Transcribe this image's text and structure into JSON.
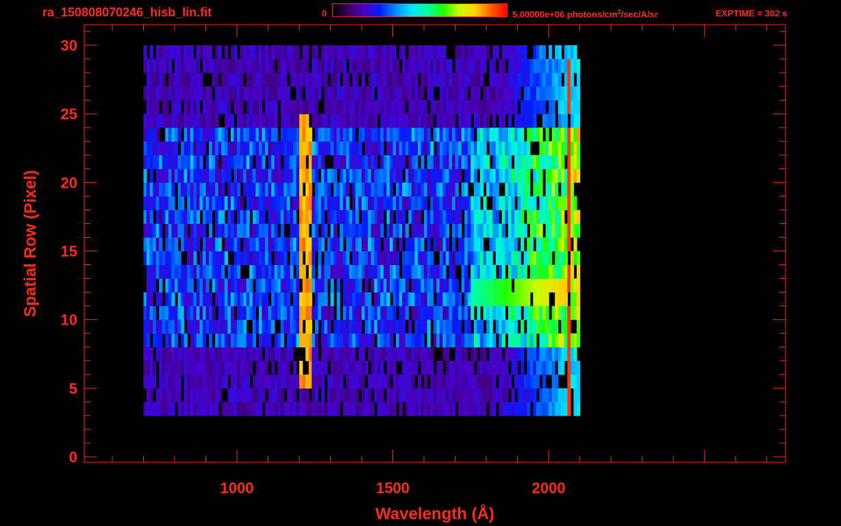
{
  "header": {
    "title": "ra_150808070246_hisb_lin.fit",
    "colorbar_min": "0",
    "colorbar_max_value": "5.00000e+06",
    "colorbar_units_prefix": "photons/cm",
    "colorbar_units_sup": "2",
    "colorbar_units_suffix": "/sec/A/sr",
    "exptime": "EXPTIME = 302 s"
  },
  "colors": {
    "text": "#ff2a1a",
    "axis": "#ff2a1a",
    "background": "#000000",
    "colormap": [
      "#000000",
      "#3a0060",
      "#4a00c8",
      "#0020ff",
      "#0090ff",
      "#00e6ff",
      "#00ffa0",
      "#20ff00",
      "#c8ff00",
      "#ffd000",
      "#ff6000",
      "#ff0000"
    ]
  },
  "chart_data": {
    "type": "heatmap",
    "xlabel": "Wavelength (Å)",
    "ylabel": "Spatial Row (Pixel)",
    "xlim": [
      510,
      2760
    ],
    "ylim": [
      -0.4,
      31.5
    ],
    "xticks": [
      1000,
      1500,
      2000
    ],
    "yticks": [
      0,
      5,
      10,
      15,
      20,
      25,
      30
    ],
    "data_extent_x": [
      700,
      2100
    ],
    "data_extent_y": [
      3,
      30
    ],
    "colorbar_range": [
      0,
      5000000
    ],
    "features": [
      {
        "label": "",
        "x": 1216,
        "rows": [
          5,
          25
        ],
        "level": 0.9
      },
      {
        "label": "",
        "x": 2064,
        "rows": [
          0,
          29
        ],
        "level": 0.95
      },
      {
        "label": "",
        "x": [
          1750,
          2060
        ],
        "rows": [
          11,
          13
        ],
        "level": 0.75
      },
      {
        "label": "",
        "x": [
          700,
          2100
        ],
        "rows": [
          8,
          24
        ],
        "level": 0.4
      }
    ],
    "grid": false,
    "legend": "colorbar top"
  }
}
